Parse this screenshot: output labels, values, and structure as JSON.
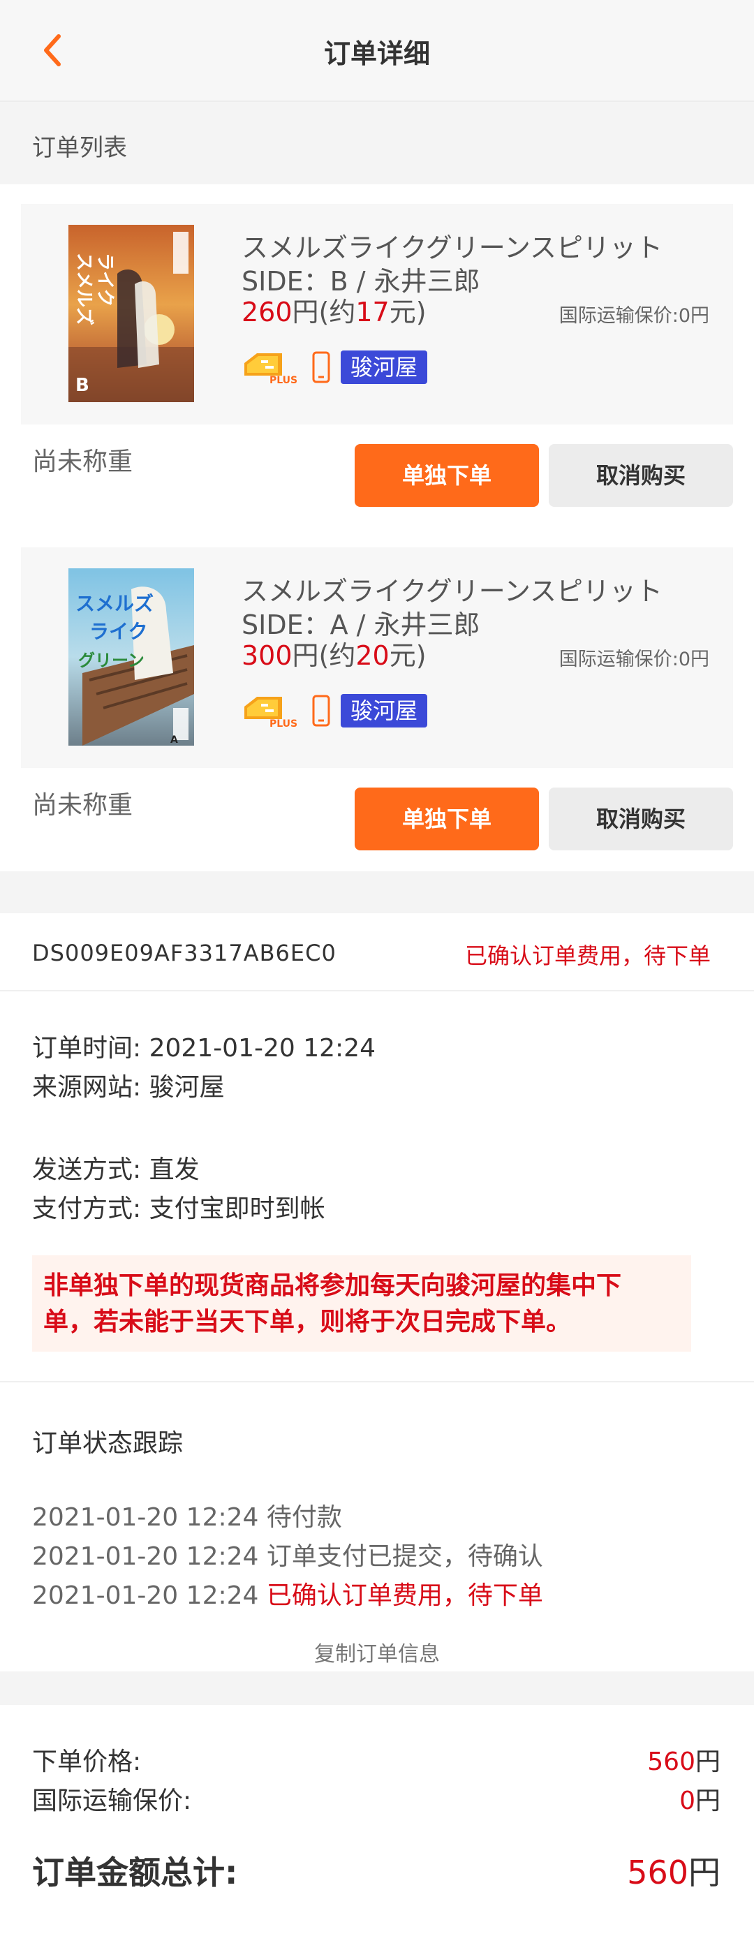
{
  "header": {
    "title": "订单详细"
  },
  "list_section": {
    "title": "订单列表"
  },
  "items": [
    {
      "title": "スメルズライクグリーンスピリット",
      "subtitle": "SIDE：B / 永井三郎",
      "price_yen": "260",
      "price_yen_unit": "円(约",
      "price_cny": "17",
      "price_cny_unit": "元)",
      "insurance": "国际运输保价:0円",
      "shop": "骏河屋",
      "weight_status": "尚未称重",
      "order_label": "单独下单",
      "cancel_label": "取消购买"
    },
    {
      "title": "スメルズライクグリーンスピリット",
      "subtitle": "SIDE：A / 永井三郎",
      "price_yen": "300",
      "price_yen_unit": "円(约",
      "price_cny": "20",
      "price_cny_unit": "元)",
      "insurance": "国际运输保价:0円",
      "shop": "骏河屋",
      "weight_status": "尚未称重",
      "order_label": "单独下单",
      "cancel_label": "取消购买"
    }
  ],
  "order": {
    "id": "DS009E09AF3317AB6EC0",
    "status": "已确认订单费用，待下单",
    "time": "订单时间: 2021-01-20 12:24",
    "source": "来源网站: 骏河屋",
    "ship_method": "发送方式: 直发",
    "pay_method": "支付方式: 支付宝即时到帐",
    "notice_line1": "非单独下单的现货商品将参加每天向骏河屋的集中下",
    "notice_line2": "单，若未能于当天下单，则将于次日完成下单。"
  },
  "tracking": {
    "title": "订单状态跟踪",
    "events": [
      {
        "time": "2021-01-20 12:24",
        "text": "待付款"
      },
      {
        "time": "2021-01-20 12:24",
        "text": "订单支付已提交，待确认"
      },
      {
        "time": "2021-01-20 12:24",
        "text": "已确认订单费用，待下单"
      }
    ],
    "copy_label": "复制订单信息"
  },
  "summary": {
    "order_price_label": "下单价格:",
    "order_price_value": "560",
    "insurance_label": "国际运输保价:",
    "insurance_value": "0",
    "currency": "円",
    "total_label": "订单金额总计:",
    "total_value": "560"
  },
  "colors": {
    "accent": "#ff6a1a",
    "price_red": "#d80c18",
    "shop_badge": "#3b49d8"
  }
}
